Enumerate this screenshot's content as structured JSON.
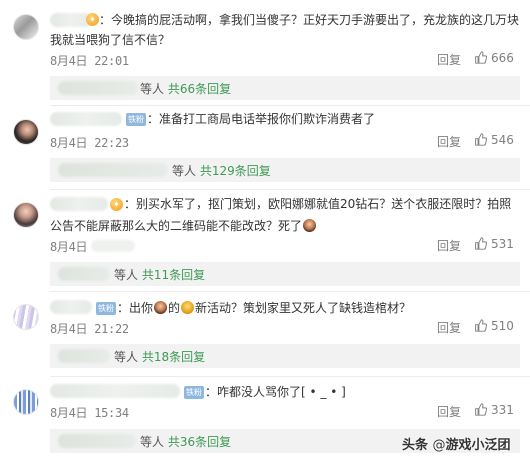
{
  "comments": [
    {
      "text_line1": "：今晚搞的屁活动啊，拿我们当傻子？正好天刀手游要出了，充龙族的这几万块",
      "text_line2": "我就当喂狗了信不信？",
      "date": "8月4日",
      "time": "22:01",
      "reply_label": "回复",
      "likes": "666",
      "thread_prefix": "等人",
      "thread_count": "共66条回复"
    },
    {
      "badge": "铁粉",
      "text_line1": "：准备打工商局电话举报你们欺诈消费者了",
      "date": "8月4日",
      "time": "22:23",
      "reply_label": "回复",
      "likes": "546",
      "thread_prefix": "等人",
      "thread_count": "共129条回复"
    },
    {
      "text_line1": "：别买水军了，抠门策划，欧阳娜娜就值20钻石？送个衣服还限时？拍照",
      "text_line2": "公告不能屏蔽那么大的二维码能不能改改？死了",
      "date": "8月4日",
      "time": "",
      "reply_label": "回复",
      "likes": "531",
      "thread_prefix": "等人",
      "thread_count": "共11条回复"
    },
    {
      "badge": "铁粉",
      "text_part1": "：出你",
      "text_part2": "的",
      "text_part3": "新活动？策划家里又死人了缺钱造棺材？",
      "date": "8月4日",
      "time": "21:22",
      "reply_label": "回复",
      "likes": "510",
      "thread_prefix": "等人",
      "thread_count": "共18条回复"
    },
    {
      "badge": "铁粉",
      "text_line1": "：咋都没人骂你了[ • _ • ]",
      "date": "8月4日",
      "time": "15:34",
      "reply_label": "回复",
      "likes": "331",
      "thread_prefix": "等人",
      "thread_count": "共36条回复"
    }
  ],
  "watermark": {
    "prefix": "头条",
    "at": "@",
    "account": "游戏小泛团"
  },
  "colors": {
    "reply_count": "#3f9a55",
    "meta": "#808080",
    "fan_badge": "#8fb8de"
  }
}
